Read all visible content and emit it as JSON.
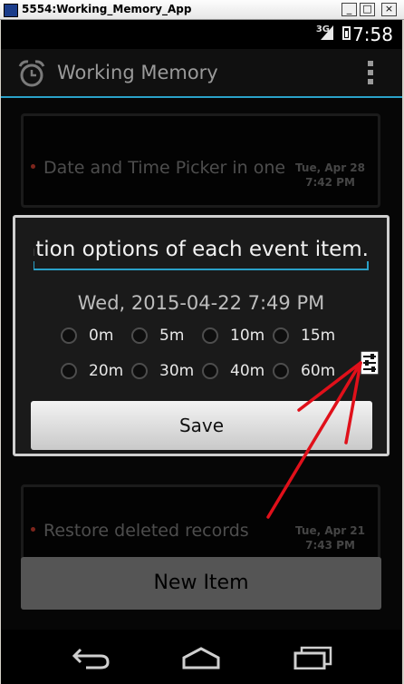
{
  "window": {
    "title": "5554:Working_Memory_App",
    "buttons": [
      "_",
      "□",
      "×"
    ]
  },
  "statusbar": {
    "network": "3G",
    "time": "7:58"
  },
  "actionbar": {
    "title": "Working Memory",
    "logo_icon": "alarm-clock-icon",
    "menu_icon": "overflow-menu-icon"
  },
  "list": {
    "items": [
      {
        "text": "Date and Time Picker in one",
        "date": "Tue, Apr 28",
        "time": "7:42 PM"
      },
      {
        "text": "Restore deleted records",
        "date": "Tue, Apr 21",
        "time": "7:43 PM"
      }
    ]
  },
  "dialog": {
    "input_value": "ation options of each event item.",
    "datetime": "Wed, 2015-04-22  7:49 PM",
    "options": [
      "0m",
      "5m",
      "10m",
      "15m",
      "20m",
      "30m",
      "40m",
      "60m"
    ],
    "config_icon": "settings-sliders-icon",
    "save_label": "Save"
  },
  "footer": {
    "new_item_label": "New Item"
  },
  "navbar": {
    "icons": [
      "back-icon",
      "home-icon",
      "recent-apps-icon"
    ]
  },
  "colors": {
    "accent": "#2aa1c8",
    "bullet": "#c0392b",
    "annotation_arrow": "#e0101a"
  }
}
